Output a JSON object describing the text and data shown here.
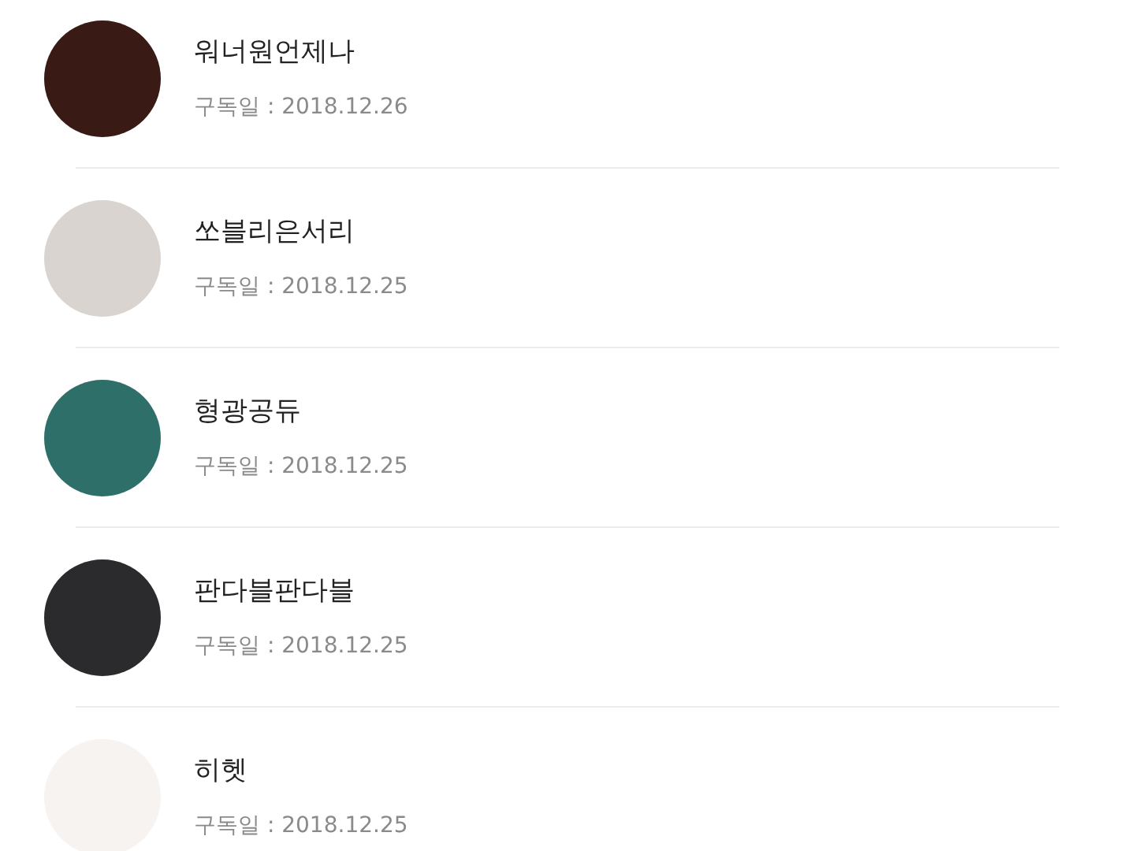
{
  "subscribers": [
    {
      "name": "워너원언제나",
      "subscribed": "구독일 : 2018.12.26"
    },
    {
      "name": "쏘블리은서리",
      "subscribed": "구독일 : 2018.12.25"
    },
    {
      "name": "형광공듀",
      "subscribed": "구독일 : 2018.12.25"
    },
    {
      "name": "판다블판다블",
      "subscribed": "구독일 : 2018.12.25"
    },
    {
      "name": "히헷",
      "subscribed": "구독일 : 2018.12.25"
    }
  ]
}
